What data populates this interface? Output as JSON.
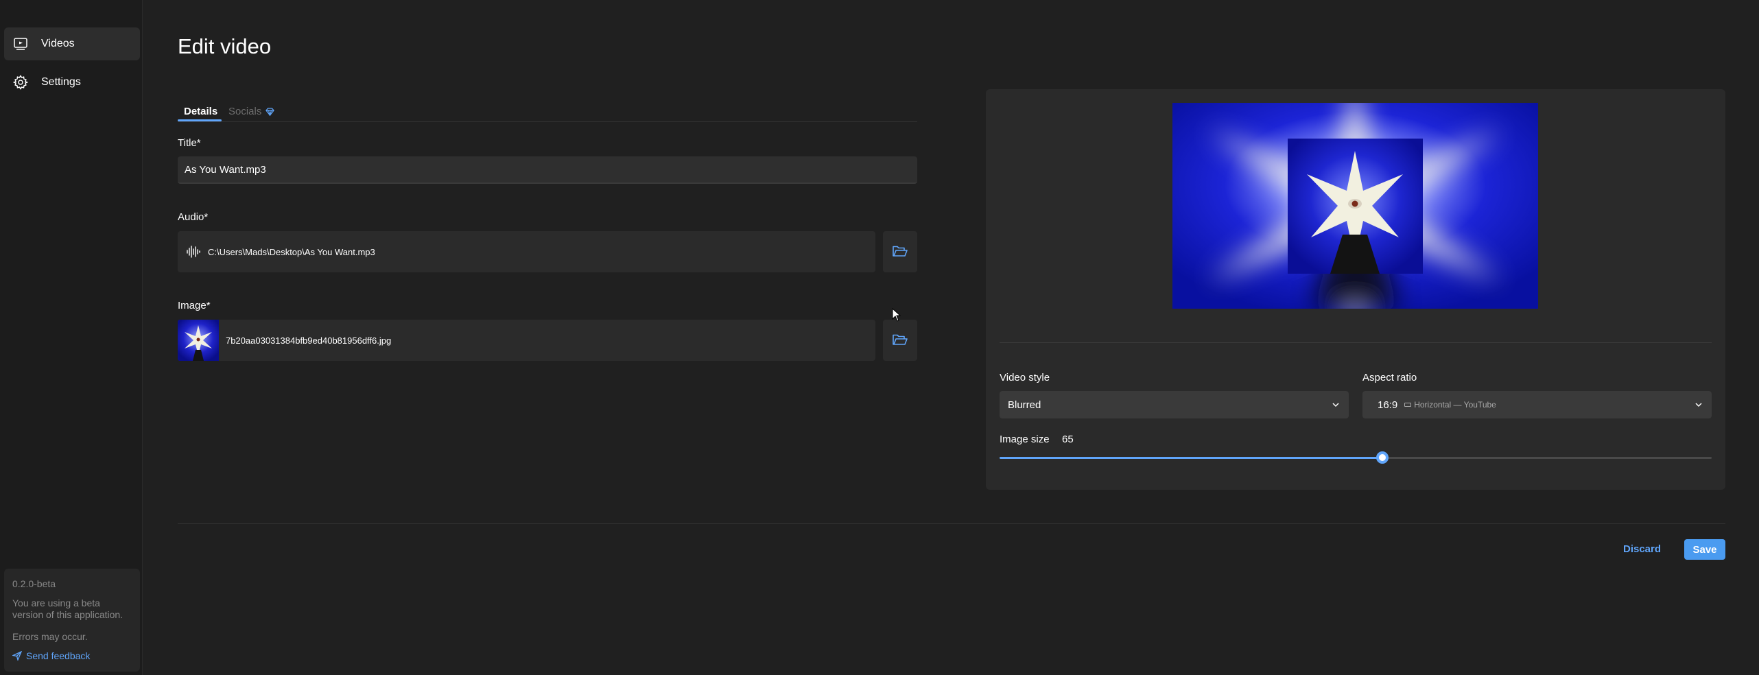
{
  "sidebar": {
    "items": [
      {
        "label": "Videos",
        "icon": "video-icon",
        "active": true
      },
      {
        "label": "Settings",
        "icon": "gear-icon",
        "active": false
      }
    ],
    "beta_card": {
      "version": "0.2.0-beta",
      "message": "You are using a beta version of this application.",
      "warning": "Errors may occur.",
      "feedback_label": "Send feedback"
    }
  },
  "main": {
    "title": "Edit video",
    "tabs": [
      {
        "label": "Details",
        "active": true
      },
      {
        "label": "Socials",
        "active": false,
        "icon": "diamond-icon"
      }
    ],
    "title_field": {
      "label": "Title*",
      "value": "As You Want.mp3"
    },
    "audio_field": {
      "label": "Audio*",
      "value": "C:\\Users\\Mads\\Desktop\\As You Want.mp3",
      "icon": "waveform-icon"
    },
    "image_field": {
      "label": "Image*",
      "value": "7b20aa03031384bfb9ed40b81956dff6.jpg"
    }
  },
  "preview_panel": {
    "video_style": {
      "label": "Video style",
      "value": "Blurred"
    },
    "aspect_ratio": {
      "label": "Aspect ratio",
      "value": "16:9",
      "description": "Horizontal — YouTube"
    },
    "image_size": {
      "label": "Image size",
      "value": "65",
      "fraction": 0.65
    }
  },
  "actions": {
    "discard_label": "Discard",
    "save_label": "Save"
  },
  "colors": {
    "accent": "#60a5fa",
    "save_bg": "#4a9bf0",
    "background": "#202020",
    "sidebar_bg": "#1c1c1c",
    "panel_bg": "#2a2a2a"
  }
}
